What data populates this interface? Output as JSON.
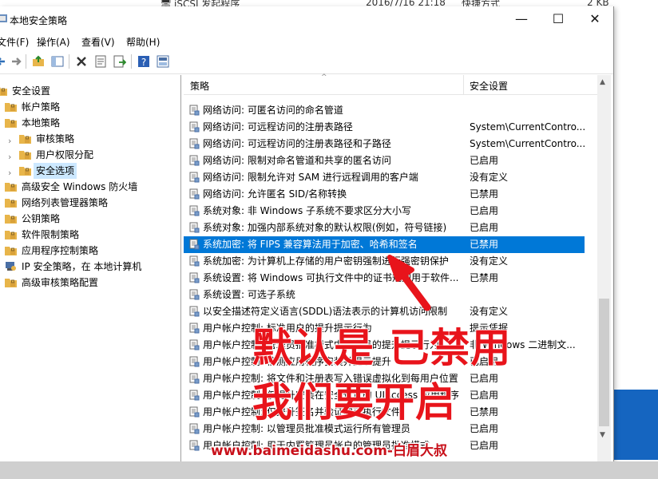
{
  "behind": {
    "name": "iSCSI 发起程序",
    "date": "2016/7/16 21:18",
    "type": "快捷方式",
    "size": "2 KB"
  },
  "window": {
    "title": "本地安全策略",
    "minimize": "—",
    "maximize": "☐",
    "close": "✕"
  },
  "menu": [
    "文件(F)",
    "操作(A)",
    "查看(V)",
    "帮助(H)"
  ],
  "toolbar": [
    "back-icon",
    "forward-icon",
    "up-folder-icon",
    "show-hide-tree-icon",
    "delete-icon",
    "properties-icon",
    "export-list-icon",
    "help-icon",
    "view-icon"
  ],
  "tree": [
    {
      "label": "安全设置",
      "indent": 0,
      "chevron": ""
    },
    {
      "label": "帐户策略",
      "indent": 1,
      "chevron": ""
    },
    {
      "label": "本地策略",
      "indent": 1,
      "chevron": ""
    },
    {
      "label": "审核策略",
      "indent": 2,
      "chevron": "›"
    },
    {
      "label": "用户权限分配",
      "indent": 2,
      "chevron": "›"
    },
    {
      "label": "安全选项",
      "indent": 2,
      "chevron": "›",
      "selected": true
    },
    {
      "label": "高级安全 Windows 防火墙",
      "indent": 1,
      "chevron": ""
    },
    {
      "label": "网络列表管理器策略",
      "indent": 1,
      "chevron": ""
    },
    {
      "label": "公钥策略",
      "indent": 1,
      "chevron": ""
    },
    {
      "label": "软件限制策略",
      "indent": 1,
      "chevron": ""
    },
    {
      "label": "应用程序控制策略",
      "indent": 1,
      "chevron": ""
    },
    {
      "label": "IP 安全策略，在 本地计算机",
      "indent": 1,
      "chevron": "",
      "icon": "ip-security-icon"
    },
    {
      "label": "高级审核策略配置",
      "indent": 1,
      "chevron": ""
    }
  ],
  "columns": {
    "policy": "策略",
    "setting": "安全设置"
  },
  "rows": [
    {
      "policy": "网络访问: 可匿名访问的命名管道",
      "setting": ""
    },
    {
      "policy": "网络访问: 可远程访问的注册表路径",
      "setting": "System\\CurrentContro..."
    },
    {
      "policy": "网络访问: 可远程访问的注册表路径和子路径",
      "setting": "System\\CurrentContro..."
    },
    {
      "policy": "网络访问: 限制对命名管道和共享的匿名访问",
      "setting": "已启用"
    },
    {
      "policy": "网络访问: 限制允许对 SAM 进行远程调用的客户端",
      "setting": "没有定义"
    },
    {
      "policy": "网络访问: 允许匿名 SID/名称转换",
      "setting": "已禁用"
    },
    {
      "policy": "系统对象: 非 Windows 子系统不要求区分大小写",
      "setting": "已启用"
    },
    {
      "policy": "系统对象: 加强内部系统对象的默认权限(例如，符号链接)",
      "setting": "已启用"
    },
    {
      "policy": "系统加密: 将 FIPS 兼容算法用于加密、哈希和签名",
      "setting": "已禁用",
      "selected": true
    },
    {
      "policy": "系统加密: 为计算机上存储的用户密钥强制进行强密钥保护",
      "setting": "没有定义"
    },
    {
      "policy": "系统设置: 将 Windows 可执行文件中的证书规则用于软件...",
      "setting": "已禁用"
    },
    {
      "policy": "系统设置: 可选子系统",
      "setting": ""
    },
    {
      "policy": "以安全描述符定义语言(SDDL)语法表示的计算机访问限制",
      "setting": "没有定义"
    },
    {
      "policy": "用户帐户控制: 标准用户的提升提示行为",
      "setting": "提示凭据"
    },
    {
      "policy": "用户帐户控制: 管理员批准模式中管理员的提升提示行为",
      "setting": "非 Windows 二进制文..."
    },
    {
      "policy": "用户帐户控制: 检测应用程序安装并提示提升",
      "setting": "已启用"
    },
    {
      "policy": "用户帐户控制: 将文件和注册表写入错误虚拟化到每用户位置",
      "setting": "已启用"
    },
    {
      "policy": "用户帐户控制: 仅提升安装在安全位置的 UIAccess 应用程序",
      "setting": "已启用"
    },
    {
      "policy": "用户帐户控制: 仅提升签名并验证的可执行文件",
      "setting": "已禁用"
    },
    {
      "policy": "用户帐户控制: 以管理员批准模式运行所有管理员",
      "setting": "已启用"
    },
    {
      "policy": "用户帐户控制: 用于内置管理员帐户的管理员批准模式",
      "setting": "已启用"
    }
  ],
  "annotation": {
    "line1": "默认是 已禁用",
    "line2": "我们要开启"
  },
  "watermark": "www.baimeidashu.com-白眉大叔",
  "colors": {
    "selection": "#0078d7",
    "annotation": "#e8141b",
    "watermark": "#c8101a",
    "folder": "#e8b54a"
  }
}
